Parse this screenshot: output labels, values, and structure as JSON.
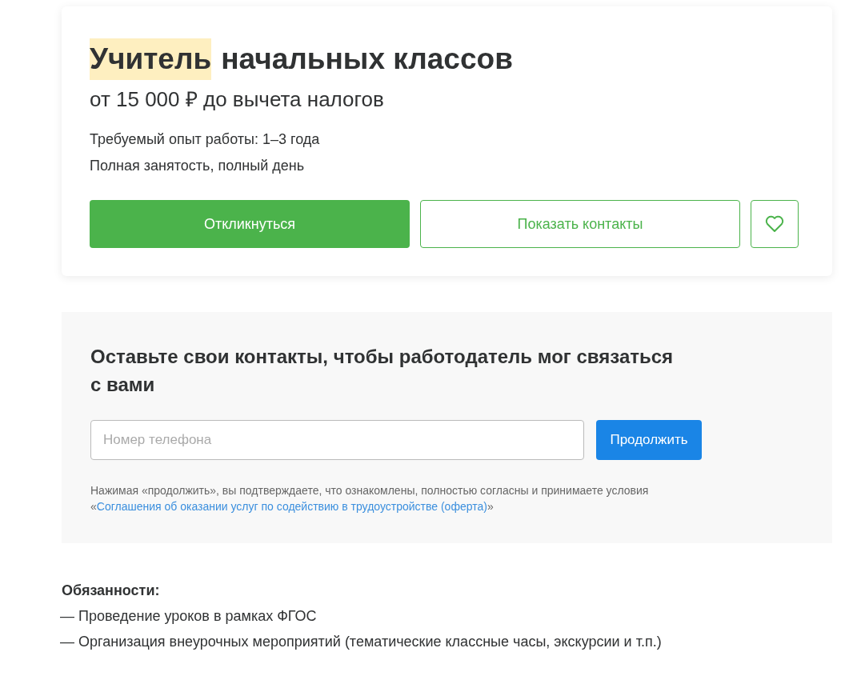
{
  "vacancy": {
    "title_parts": [
      {
        "text": "Учитель",
        "highlighted": true
      },
      {
        "text": "начальных классов",
        "highlighted": false
      }
    ],
    "salary": "от 15 000 ₽ до вычета налогов",
    "details": [
      "Требуемый опыт работы: 1–3 года",
      "Полная занятость, полный день"
    ],
    "respond_button": "Откликнуться",
    "contacts_button": "Показать контакты",
    "favorite": {
      "selected": false
    }
  },
  "contact_form": {
    "heading": "Оставьте свои контакты, чтобы работодатель мог связаться с вами",
    "phone_placeholder": "Номер телефона",
    "continue_button": "Продолжить",
    "disclaimer": {
      "text": "Нажимая «продолжить», вы подтверждаете, что ознакомлены, полностью согласны и принимаете условия",
      "prefix": "«",
      "link": "Соглашения об оказании услуг по содействию в трудоустройстве (оферта)",
      "suffix": "»"
    }
  },
  "duties": {
    "heading": "Обязанности:",
    "items": [
      "— Проведение уроков в рамках ФГОС",
      "— Организация внеурочных мероприятий (тематические классные часы, экскурсии и т.п.)"
    ]
  }
}
